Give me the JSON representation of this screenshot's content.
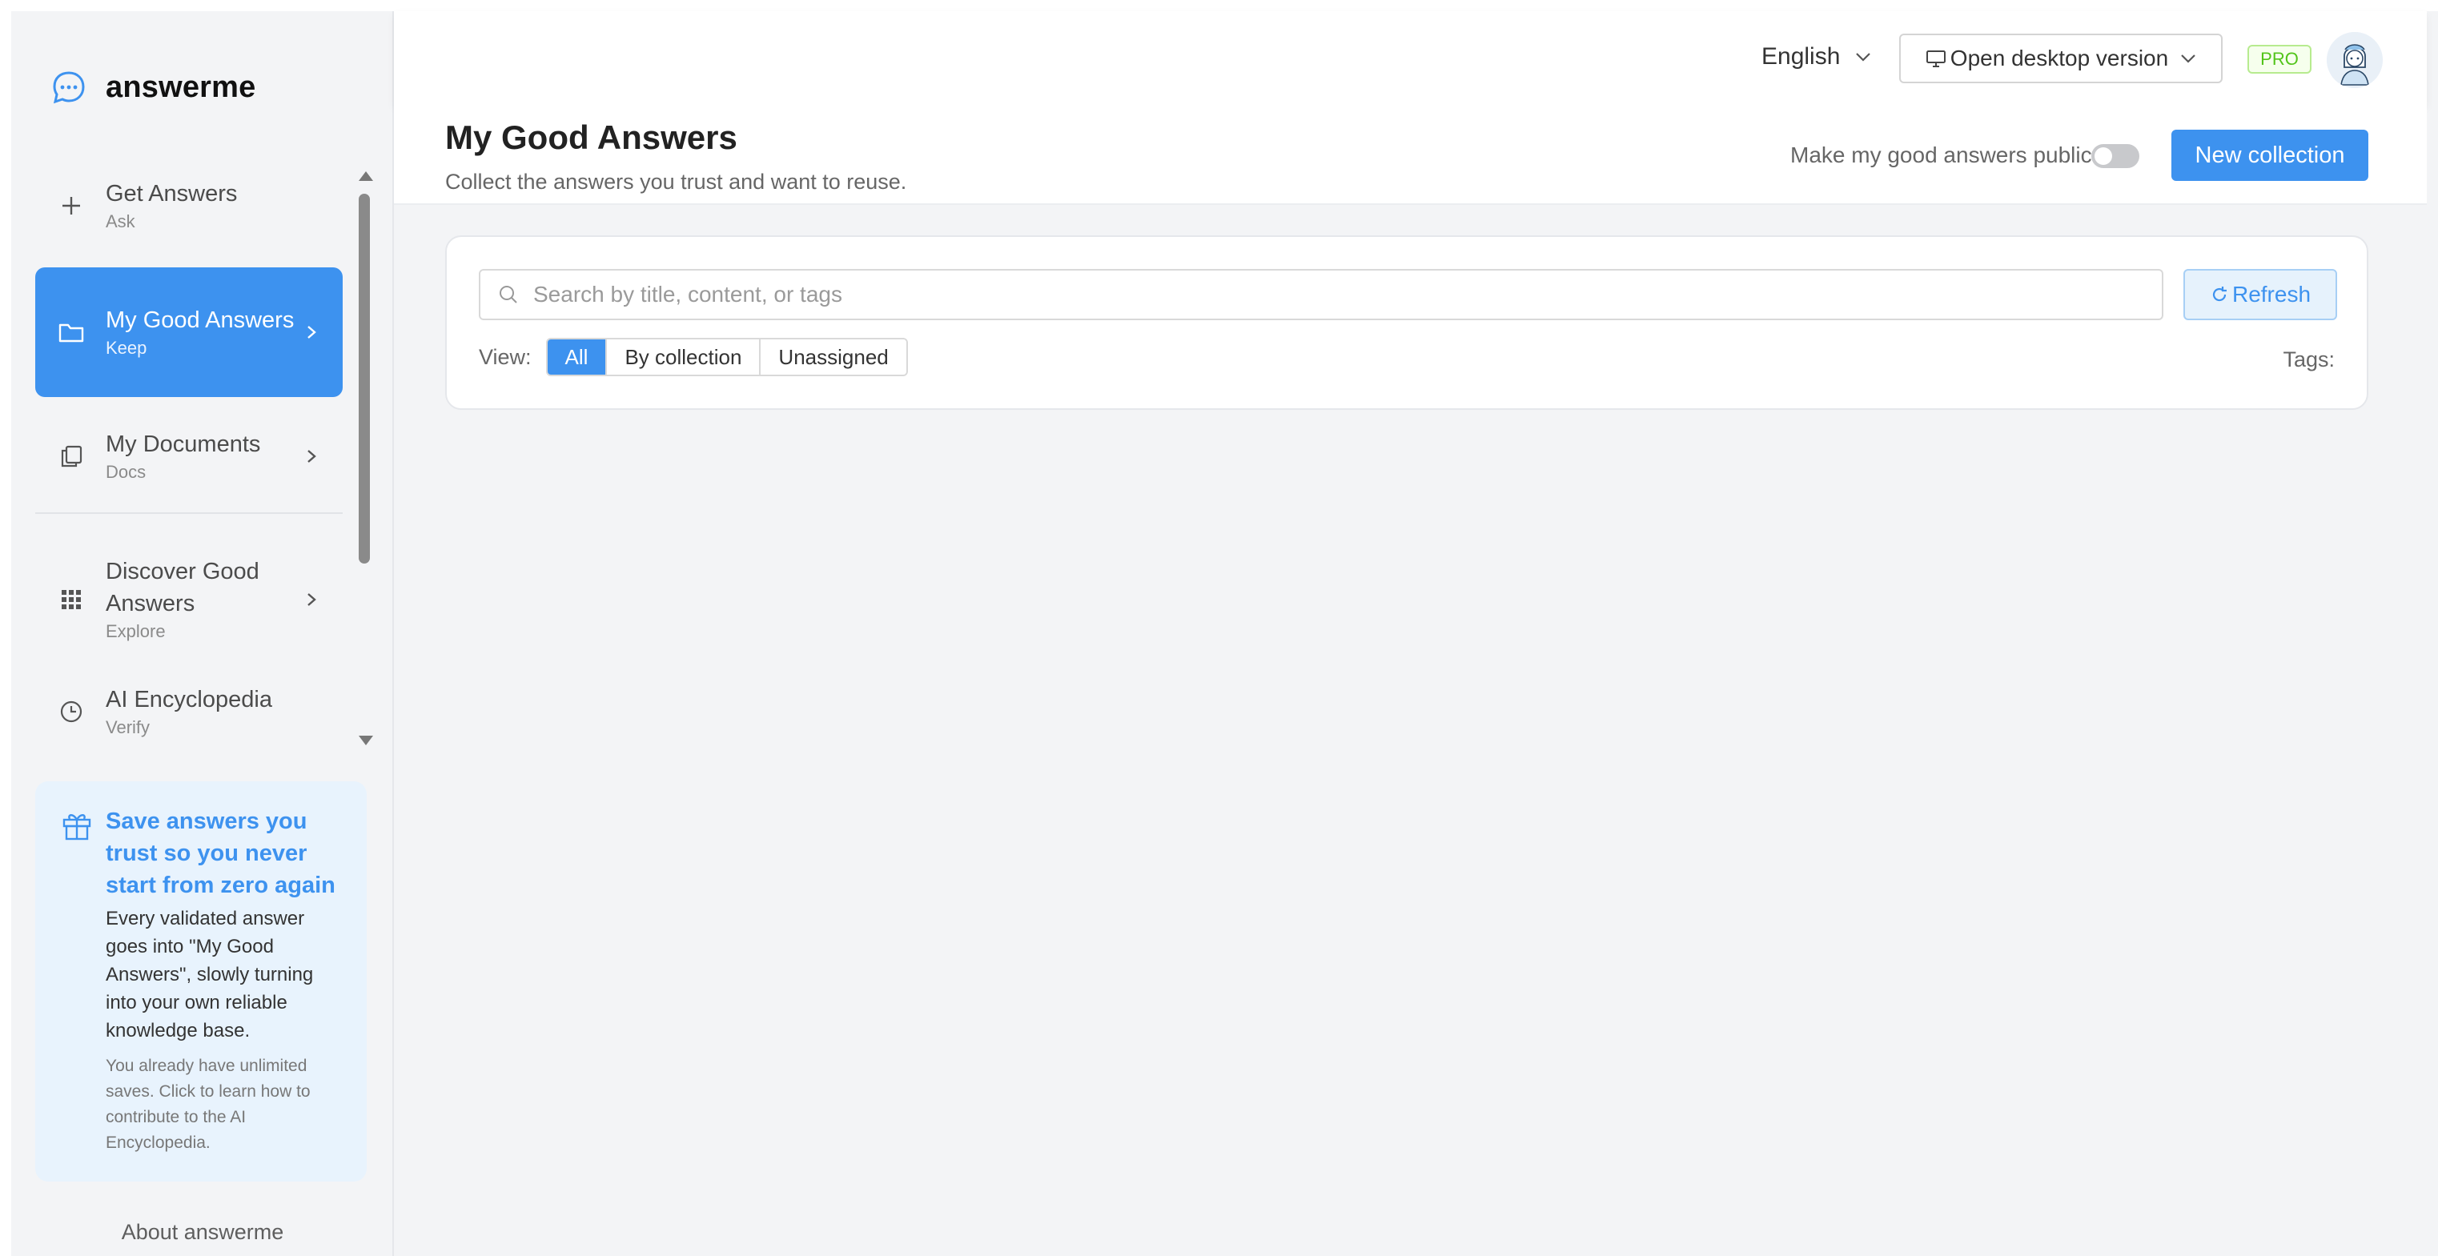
{
  "app": {
    "name": "answerme"
  },
  "sidebar": {
    "items": [
      {
        "label": "Get Answers",
        "sub": "Ask"
      },
      {
        "label": "My Good Answers",
        "sub": "Keep"
      },
      {
        "label": "My Documents",
        "sub": "Docs"
      },
      {
        "label": "Discover Good Answers",
        "sub": "Explore"
      },
      {
        "label": "AI Encyclopedia",
        "sub": "Verify"
      }
    ],
    "active_index": 1,
    "promo": {
      "title": "Save answers you trust so you never start from zero again",
      "body": "Every validated answer goes into \"My Good Answers\", slowly turning into your own reliable knowledge base.",
      "note": "You already have unlimited saves. Click to learn how to contribute to the AI Encyclopedia."
    },
    "about": "About answerme"
  },
  "topbar": {
    "language": "English",
    "desktop_button": "Open desktop version",
    "pro_badge": "PRO"
  },
  "page": {
    "title": "My Good Answers",
    "subtitle": "Collect the answers you trust and want to reuse.",
    "public_toggle_label": "Make my good answers public",
    "public_toggle_on": false,
    "new_collection": "New collection"
  },
  "filters": {
    "search_placeholder": "Search by title, content, or tags",
    "refresh": "Refresh",
    "view_label": "View:",
    "view_options": [
      "All",
      "By collection",
      "Unassigned"
    ],
    "view_selected": "All",
    "tags_label": "Tags:"
  },
  "colors": {
    "accent": "#3d92ef",
    "pro_green": "#52c41a",
    "background": "#f3f4f6"
  }
}
